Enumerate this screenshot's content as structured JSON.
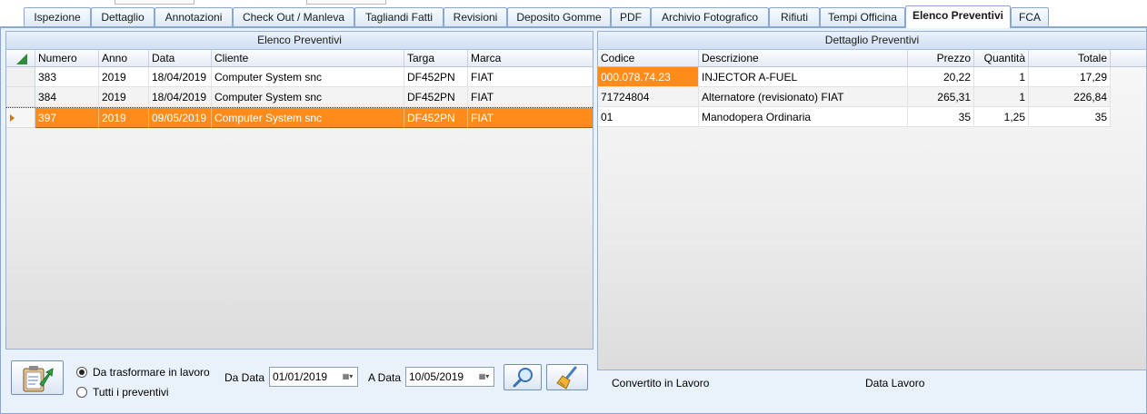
{
  "tabs": [
    {
      "label": "Ispezione"
    },
    {
      "label": "Dettaglio"
    },
    {
      "label": "Annotazioni"
    },
    {
      "label": "Check Out / Manleva"
    },
    {
      "label": "Tagliandi Fatti"
    },
    {
      "label": "Revisioni"
    },
    {
      "label": "Deposito Gomme"
    },
    {
      "label": "PDF"
    },
    {
      "label": "Archivio Fotografico"
    },
    {
      "label": "Rifiuti"
    },
    {
      "label": "Tempi Officina"
    },
    {
      "label": "Elenco Preventivi",
      "active": true
    },
    {
      "label": "FCA"
    }
  ],
  "left_grid": {
    "title": "Elenco Preventivi",
    "columns": [
      "Numero",
      "Anno",
      "Data",
      "Cliente",
      "Targa",
      "Marca"
    ],
    "rows": [
      {
        "numero": "383",
        "anno": "2019",
        "data": "18/04/2019",
        "cliente": "Computer System snc",
        "targa": "DF452PN",
        "marca": "FIAT",
        "selected": false
      },
      {
        "numero": "384",
        "anno": "2019",
        "data": "18/04/2019",
        "cliente": "Computer System snc",
        "targa": "DF452PN",
        "marca": "FIAT",
        "selected": false
      },
      {
        "numero": "397",
        "anno": "2019",
        "data": "09/05/2019",
        "cliente": "Computer System snc",
        "targa": "DF452PN",
        "marca": "FIAT",
        "selected": true
      }
    ]
  },
  "right_grid": {
    "title": "Dettaglio Preventivi",
    "columns": [
      "Codice",
      "Descrizione",
      "Prezzo",
      "Quantità",
      "Totale"
    ],
    "rows": [
      {
        "codice": "000.078.74.23",
        "descrizione": "INJECTOR A-FUEL",
        "prezzo": "20,22",
        "quantita": "1",
        "totale": "17,29",
        "highlight": true
      },
      {
        "codice": "71724804",
        "descrizione": "Alternatore (revisionato) FIAT",
        "prezzo": "265,31",
        "quantita": "1",
        "totale": "226,84"
      },
      {
        "codice": "01",
        "descrizione": "Manodopera Ordinaria",
        "prezzo": "35",
        "quantita": "1,25",
        "totale": "35"
      }
    ]
  },
  "filters": {
    "radio_trasformare": "Da trasformare in lavoro",
    "radio_tutti": "Tutti i preventivi",
    "selected": "trasformare",
    "da_data_label": "Da Data",
    "da_data_value": "01/01/2019",
    "a_data_label": "A Data",
    "a_data_value": "10/05/2019"
  },
  "status": {
    "convertito_label": "Convertito in Lavoro",
    "data_lavoro_label": "Data Lavoro"
  },
  "colors": {
    "selection": "#ff8c1a",
    "frame": "#e9f1fb",
    "border": "#8aa7cf"
  },
  "icons": {
    "convert_button": "clipboard-arrow-icon",
    "search_button": "magnifier-icon",
    "clear_button": "broom-icon"
  }
}
